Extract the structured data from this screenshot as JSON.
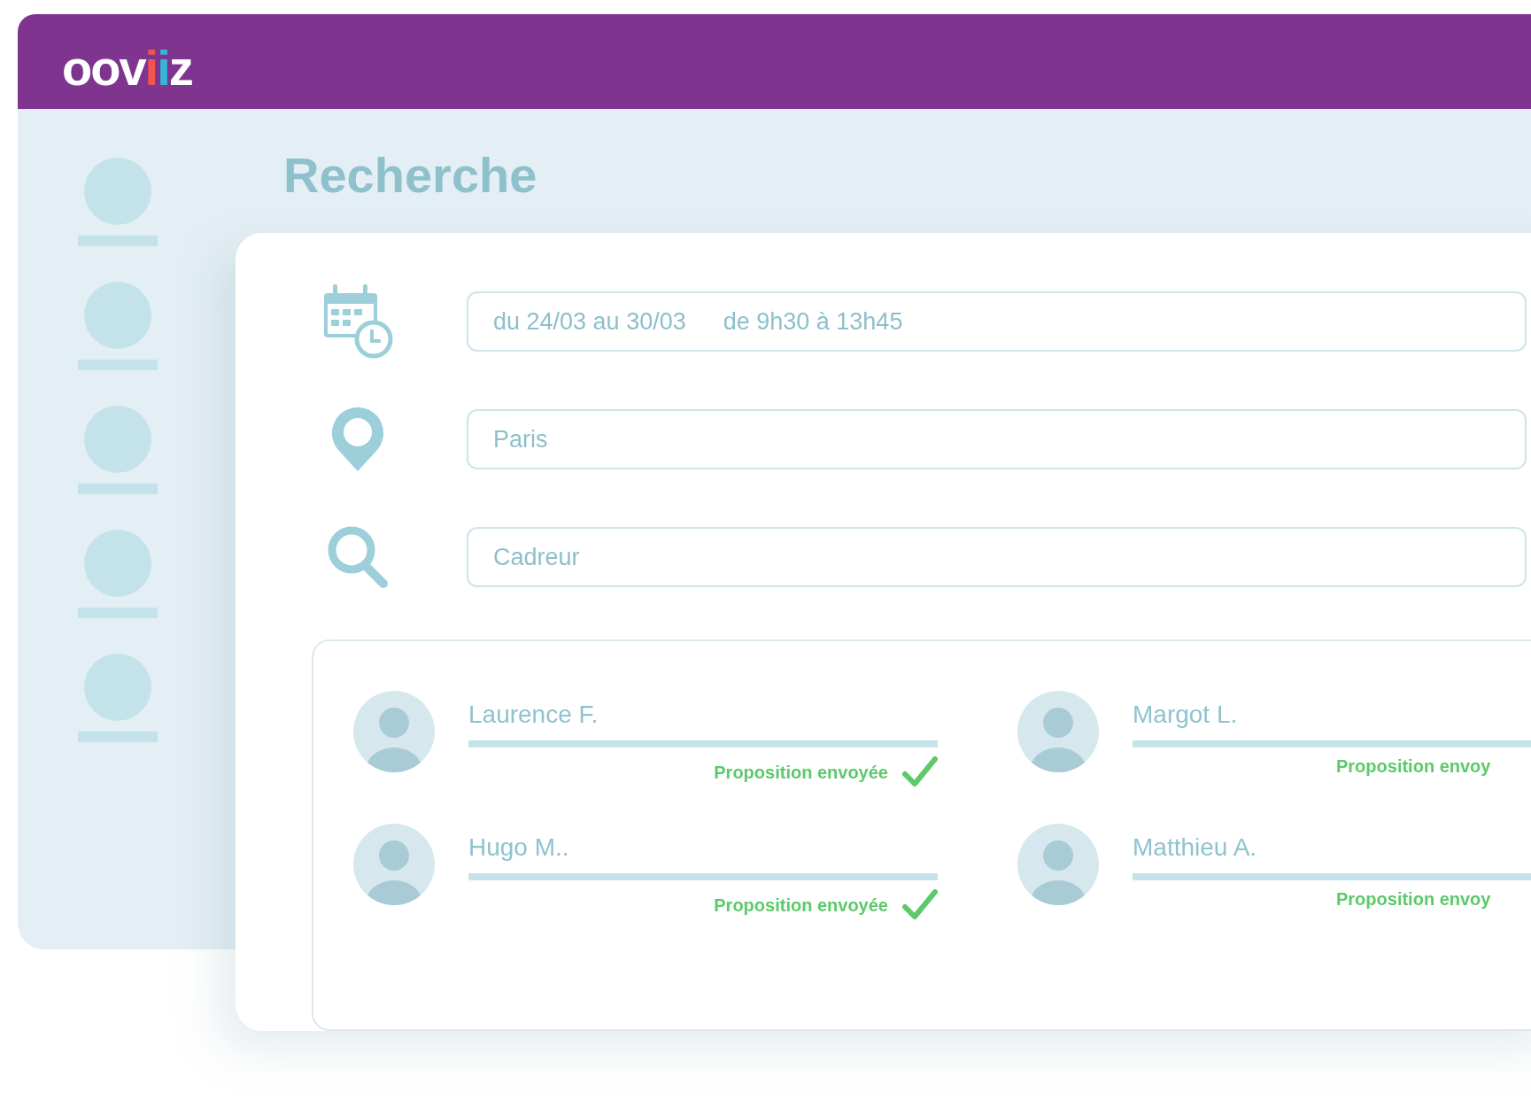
{
  "header": {
    "logo": [
      {
        "text": "oov",
        "color": "#ffffff"
      },
      {
        "text": "i",
        "color": "#f0564f"
      },
      {
        "text": "i",
        "color": "#33b8d6"
      },
      {
        "text": "z",
        "color": "#ffffff"
      }
    ]
  },
  "title": "Recherche",
  "fields": [
    {
      "kind": "date",
      "values": [
        "du 24/03 au 30/03",
        "de 9h30 à 13h45"
      ]
    },
    {
      "kind": "location",
      "values": [
        "Paris"
      ]
    },
    {
      "kind": "search",
      "values": [
        "Cadreur"
      ]
    }
  ],
  "results": [
    {
      "name": "Laurence F.",
      "status": "Proposition envoyée",
      "checked": true
    },
    {
      "name": "Margot L.",
      "status": "Proposition envoy"
    },
    {
      "name": "Hugo M..",
      "status": "Proposition envoyée",
      "checked": true
    },
    {
      "name": "Matthieu A.",
      "status": "Proposition envoy"
    }
  ]
}
